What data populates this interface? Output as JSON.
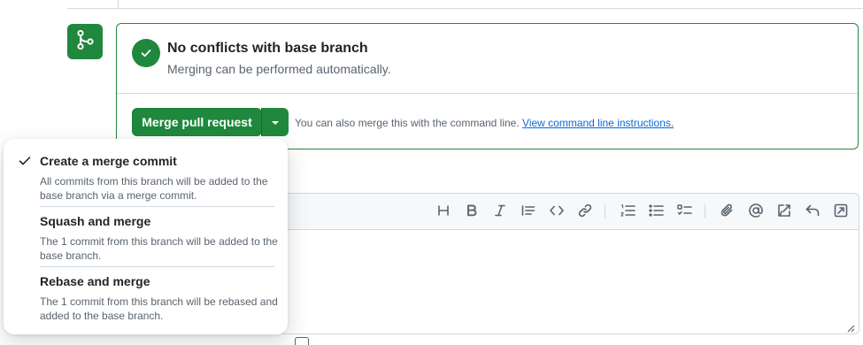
{
  "status": {
    "title": "No conflicts with base branch",
    "subtitle": "Merging can be performed automatically."
  },
  "merge_button": {
    "label": "Merge pull request"
  },
  "command_line": {
    "text": "You can also merge this with the command line. ",
    "link": "View command line instructions."
  },
  "merge_menu": {
    "items": [
      {
        "title": "Create a merge commit",
        "description": "All commits from this branch will be added to the base branch via a merge commit.",
        "selected": true
      },
      {
        "title": "Squash and merge",
        "description": "The 1 commit from this branch will be added to the base branch.",
        "selected": false
      },
      {
        "title": "Rebase and merge",
        "description": "The 1 commit from this branch will be rebased and added to the base branch.",
        "selected": false
      }
    ]
  },
  "editor_toolbar": {
    "icons": [
      "heading-icon",
      "bold-icon",
      "italic-icon",
      "quote-icon",
      "code-icon",
      "link-icon",
      "ordered-list-icon",
      "unordered-list-icon",
      "task-list-icon",
      "attach-icon",
      "mention-icon",
      "reference-icon",
      "reply-icon",
      "fullscreen-icon"
    ]
  },
  "colors": {
    "accent_green": "#1f883d",
    "link_blue": "#0969da",
    "muted_text": "#59636e",
    "border": "#d1d9e0"
  }
}
